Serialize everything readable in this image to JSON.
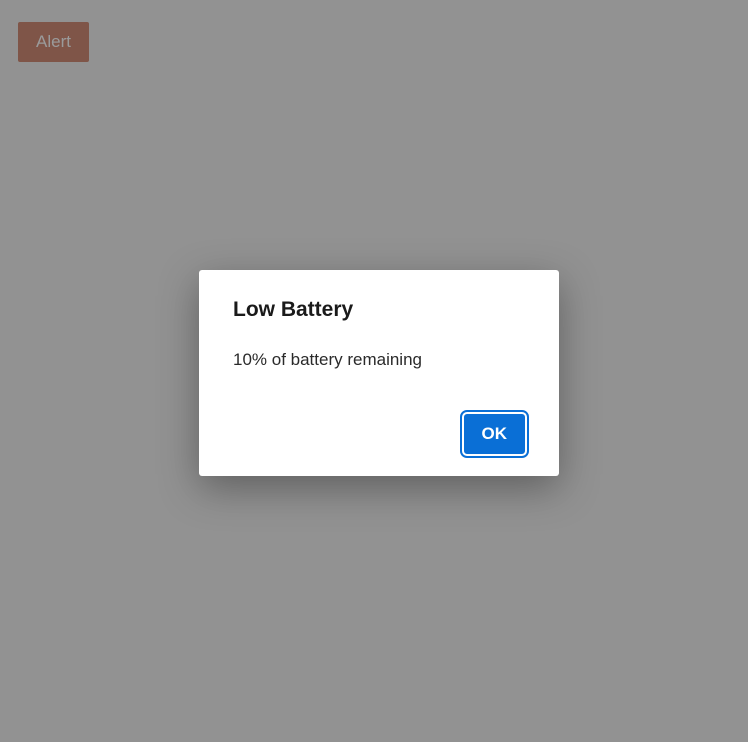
{
  "trigger": {
    "label": "Alert"
  },
  "dialog": {
    "title": "Low Battery",
    "message": "10% of battery remaining",
    "ok_label": "OK"
  }
}
